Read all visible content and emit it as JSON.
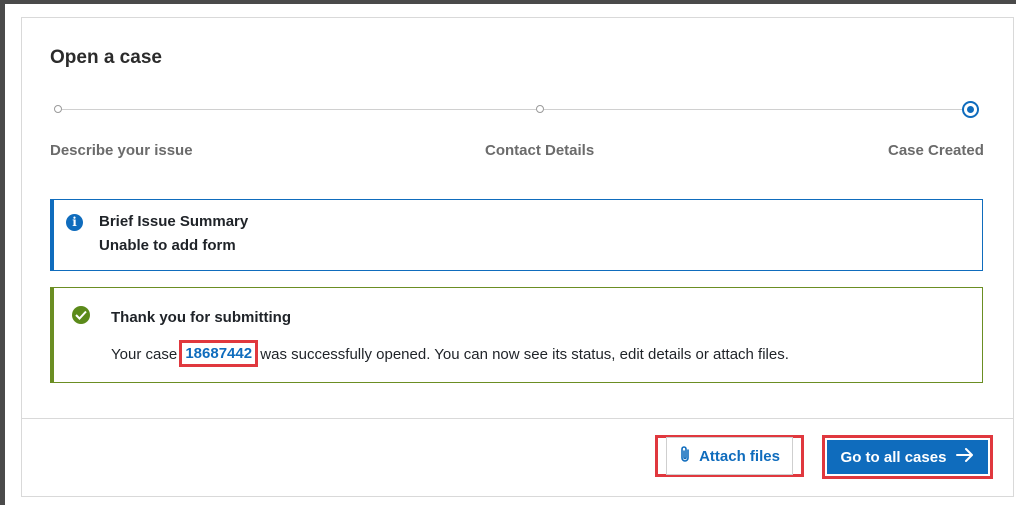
{
  "card": {
    "title": "Open a case"
  },
  "stepper": {
    "steps": [
      {
        "label": "Describe your issue",
        "state": "inactive"
      },
      {
        "label": "Contact Details",
        "state": "inactive"
      },
      {
        "label": "Case Created",
        "state": "active"
      }
    ]
  },
  "info": {
    "icon": "info-icon",
    "title": "Brief Issue Summary",
    "text": "Unable to add form"
  },
  "success": {
    "icon": "check-circle-icon",
    "title": "Thank you for submitting",
    "text_before": "Your case",
    "case_number": "18687442",
    "text_after": "was successfully opened. You can now see its status, edit details or attach files."
  },
  "actions": {
    "attach_label": "Attach files",
    "attach_icon": "paperclip-icon",
    "goto_label": "Go to all cases",
    "goto_icon": "arrow-right-icon"
  },
  "colors": {
    "primary": "#0f6cbd",
    "success": "#6b8e23",
    "highlight": "#e0383e"
  }
}
